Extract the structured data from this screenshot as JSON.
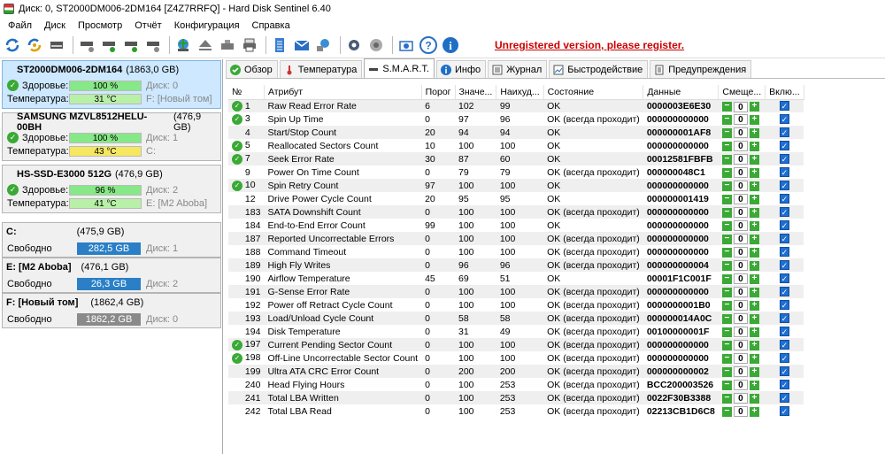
{
  "window": {
    "title": "Диск: 0, ST2000DM006-2DM164 [Z4Z7RRFQ]  -  Hard Disk Sentinel 6.40"
  },
  "menu": [
    "Файл",
    "Диск",
    "Просмотр",
    "Отчёт",
    "Конфигурация",
    "Справка"
  ],
  "toolbar": {
    "register_text": "Unregistered version, please register.",
    "icons": [
      "refresh-icon",
      "refresh-all-icon",
      "disk-icon",
      "disk-test-icon",
      "disk-test2-icon",
      "disk-test3-icon",
      "disk-test4-icon",
      "globe-icon",
      "eject-icon",
      "tools-icon",
      "printer-icon",
      "report-icon",
      "email-icon",
      "network-icon",
      "settings-icon",
      "sound-icon",
      "screenshot-icon",
      "help-icon",
      "info-icon"
    ]
  },
  "disks": [
    {
      "name": "ST2000DM006-2DM164",
      "size": "(1863,0 GB)",
      "health_label": "Здоровье:",
      "health": "100 %",
      "disk_ref": "Диск: 0",
      "temp_label": "Температура:",
      "temp": "31 °C",
      "vol_ref": "F: [Новый том]",
      "selected": true
    },
    {
      "name": "SAMSUNG MZVL8512HELU-00BH",
      "size": "(476,9 GB)",
      "health_label": "Здоровье:",
      "health": "100 %",
      "disk_ref": "Диск: 1",
      "temp_label": "Температура:",
      "temp": "43 °C",
      "vol_ref": "C:",
      "selected": false
    },
    {
      "name": "HS-SSD-E3000 512G",
      "size": "(476,9 GB)",
      "health_label": "Здоровье:",
      "health": "96 %",
      "disk_ref": "Диск: 2",
      "temp_label": "Температура:",
      "temp": "41 °C",
      "vol_ref": "E: [M2 Aboba]",
      "selected": false
    }
  ],
  "volumes": [
    {
      "name": "C:",
      "size": "(475,9 GB)",
      "free_label": "Свободно",
      "free": "282,5 GB",
      "disk_ref": "Диск: 1",
      "color": "blue",
      "fill": 0.5936
    },
    {
      "name": "E: [M2 Aboba]",
      "size": "(476,1 GB)",
      "free_label": "Свободно",
      "free": "26,3 GB",
      "disk_ref": "Диск: 2",
      "color": "blue",
      "fill": 0.0552
    },
    {
      "name": "F: [Новый том]",
      "size": "(1862,4 GB)",
      "free_label": "Свободно",
      "free": "1862,2 GB",
      "disk_ref": "Диск: 0",
      "color": "gray",
      "fill": 0.9999
    }
  ],
  "tabs": [
    {
      "label": "Обзор",
      "icon": "check-icon"
    },
    {
      "label": "Температура",
      "icon": "thermometer-icon"
    },
    {
      "label": "S.M.A.R.T.",
      "icon": "smart-icon",
      "active": true
    },
    {
      "label": "Инфо",
      "icon": "info-icon"
    },
    {
      "label": "Журнал",
      "icon": "log-icon"
    },
    {
      "label": "Быстродействие",
      "icon": "performance-icon"
    },
    {
      "label": "Предупреждения",
      "icon": "warnings-icon"
    }
  ],
  "smart": {
    "columns": [
      "№",
      "Атрибут",
      "Порог",
      "Значе...",
      "Наихуд...",
      "Состояние",
      "Данные",
      "Смеще...",
      "Вклю..."
    ],
    "rows": [
      {
        "ok": true,
        "id": "1",
        "name": "Raw Read Error Rate",
        "thr": "6",
        "val": "102",
        "worst": "99",
        "state": "OK",
        "data": "0000003E6E30"
      },
      {
        "ok": true,
        "id": "3",
        "name": "Spin Up Time",
        "thr": "0",
        "val": "97",
        "worst": "96",
        "state": "OK (всегда проходит)",
        "data": "000000000000"
      },
      {
        "ok": false,
        "id": "4",
        "name": "Start/Stop Count",
        "thr": "20",
        "val": "94",
        "worst": "94",
        "state": "OK",
        "data": "000000001AF8"
      },
      {
        "ok": true,
        "id": "5",
        "name": "Reallocated Sectors Count",
        "thr": "10",
        "val": "100",
        "worst": "100",
        "state": "OK",
        "data": "000000000000"
      },
      {
        "ok": true,
        "id": "7",
        "name": "Seek Error Rate",
        "thr": "30",
        "val": "87",
        "worst": "60",
        "state": "OK",
        "data": "00012581FBFB"
      },
      {
        "ok": false,
        "id": "9",
        "name": "Power On Time Count",
        "thr": "0",
        "val": "79",
        "worst": "79",
        "state": "OK (всегда проходит)",
        "data": "000000048C1"
      },
      {
        "ok": true,
        "id": "10",
        "name": "Spin Retry Count",
        "thr": "97",
        "val": "100",
        "worst": "100",
        "state": "OK",
        "data": "000000000000"
      },
      {
        "ok": false,
        "id": "12",
        "name": "Drive Power Cycle Count",
        "thr": "20",
        "val": "95",
        "worst": "95",
        "state": "OK",
        "data": "000000001419"
      },
      {
        "ok": false,
        "id": "183",
        "name": "SATA Downshift Count",
        "thr": "0",
        "val": "100",
        "worst": "100",
        "state": "OK (всегда проходит)",
        "data": "000000000000"
      },
      {
        "ok": false,
        "id": "184",
        "name": "End-to-End Error Count",
        "thr": "99",
        "val": "100",
        "worst": "100",
        "state": "OK",
        "data": "000000000000"
      },
      {
        "ok": false,
        "id": "187",
        "name": "Reported Uncorrectable Errors",
        "thr": "0",
        "val": "100",
        "worst": "100",
        "state": "OK (всегда проходит)",
        "data": "000000000000"
      },
      {
        "ok": false,
        "id": "188",
        "name": "Command Timeout",
        "thr": "0",
        "val": "100",
        "worst": "100",
        "state": "OK (всегда проходит)",
        "data": "000000000000"
      },
      {
        "ok": false,
        "id": "189",
        "name": "High Fly Writes",
        "thr": "0",
        "val": "96",
        "worst": "96",
        "state": "OK (всегда проходит)",
        "data": "000000000004"
      },
      {
        "ok": false,
        "id": "190",
        "name": "Airflow Temperature",
        "thr": "45",
        "val": "69",
        "worst": "51",
        "state": "OK",
        "data": "00001F1C001F"
      },
      {
        "ok": false,
        "id": "191",
        "name": "G-Sense Error Rate",
        "thr": "0",
        "val": "100",
        "worst": "100",
        "state": "OK (всегда проходит)",
        "data": "000000000000"
      },
      {
        "ok": false,
        "id": "192",
        "name": "Power off Retract Cycle Count",
        "thr": "0",
        "val": "100",
        "worst": "100",
        "state": "OK (всегда проходит)",
        "data": "0000000001B0"
      },
      {
        "ok": false,
        "id": "193",
        "name": "Load/Unload Cycle Count",
        "thr": "0",
        "val": "58",
        "worst": "58",
        "state": "OK (всегда проходит)",
        "data": "000000014A0C"
      },
      {
        "ok": false,
        "id": "194",
        "name": "Disk Temperature",
        "thr": "0",
        "val": "31",
        "worst": "49",
        "state": "OK (всегда проходит)",
        "data": "00100000001F"
      },
      {
        "ok": true,
        "id": "197",
        "name": "Current Pending Sector Count",
        "thr": "0",
        "val": "100",
        "worst": "100",
        "state": "OK (всегда проходит)",
        "data": "000000000000"
      },
      {
        "ok": true,
        "id": "198",
        "name": "Off-Line Uncorrectable Sector Count",
        "thr": "0",
        "val": "100",
        "worst": "100",
        "state": "OK (всегда проходит)",
        "data": "000000000000"
      },
      {
        "ok": false,
        "id": "199",
        "name": "Ultra ATA CRC Error Count",
        "thr": "0",
        "val": "200",
        "worst": "200",
        "state": "OK (всегда проходит)",
        "data": "000000000002"
      },
      {
        "ok": false,
        "id": "240",
        "name": "Head Flying Hours",
        "thr": "0",
        "val": "100",
        "worst": "253",
        "state": "OK (всегда проходит)",
        "data": "BCC200003526"
      },
      {
        "ok": false,
        "id": "241",
        "name": "Total LBA Written",
        "thr": "0",
        "val": "100",
        "worst": "253",
        "state": "OK (всегда проходит)",
        "data": "0022F30B3388"
      },
      {
        "ok": false,
        "id": "242",
        "name": "Total LBA Read",
        "thr": "0",
        "val": "100",
        "worst": "253",
        "state": "OK (всегда проходит)",
        "data": "02213CB1D6C8"
      }
    ],
    "offset_value": "0"
  }
}
